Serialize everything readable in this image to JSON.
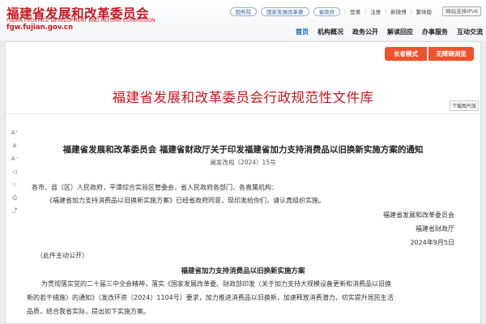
{
  "header": {
    "org_name": "福建省发展和改革委员会",
    "org_sub": "FUJIAN PROVINCE DEVELOPMENT AND REFORM COMMISSION",
    "domain": "fgw.fujian.gov.cn",
    "top_pills": [
      "国务院",
      "国家发展改革委",
      "省政府"
    ],
    "login": "登录",
    "register": "注册",
    "weibo": "新微博",
    "traditional": "繁体版",
    "ipv6": "网站支持IPv6"
  },
  "nav": {
    "items": [
      "首页",
      "机构概况",
      "政务公开",
      "解读回应",
      "办事服务",
      "互动交流"
    ],
    "active_index": 0,
    "active_color": "#0a5eb8"
  },
  "banner": {
    "elder_mode": "长者模式",
    "accessible": "无障碍浏览",
    "library_title": "福建省发展和改革委员会行政规范性文件库",
    "download_image": "下载图片版"
  },
  "tools": [
    "A⁺",
    "A",
    "A⁻",
    "◁",
    "☆",
    "⎙",
    "⤴"
  ],
  "document": {
    "title": "福建省发展和改革委员会 福建省财政厅关于印发福建省加力支持消费品以旧换新实施方案的通知",
    "doc_number": "闽发改规〔2024〕15号",
    "recipients": "各市、县（区）人民政府，平潭综合实验区管委会，省人民政府各部门、各直属机构：",
    "intro": "《福建省加力支持消费品以旧换新实施方案》已经省政府同意，现印发给你们，请认真组织实施。",
    "signer_1": "福建省发展和改革委员会",
    "signer_2": "福建省财政厅",
    "date": "2024年9月5日",
    "disclosure": "（此件主动公开）",
    "plan_title": "福建省加力支持消费品以旧换新实施方案",
    "body_line_1": "为贯彻落实党的二十届三中全会精神，落实《国家发展改革委、财政部印发〈关于加力支持大规模设备更新和消费品以旧换",
    "body_line_2": "新的若干措施〉的通知》（发改环资〔2024〕1104号）要求，加力推进消费品以旧换新，加速释放消费潜力，切实提升居民生活",
    "body_line_3": "品质，结合我省实际，提出如下实施方案。"
  },
  "colors": {
    "brand_red": "#c8161d",
    "orange_button": "#f0522c"
  }
}
